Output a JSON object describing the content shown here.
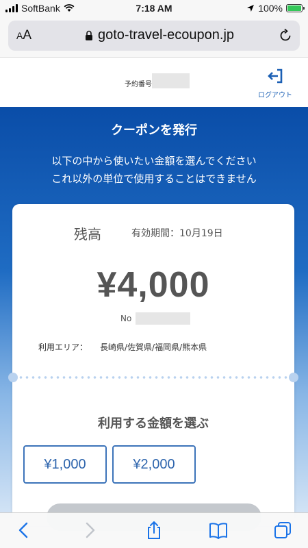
{
  "status_bar": {
    "carrier": "SoftBank",
    "time": "7:18 AM",
    "battery": "100%"
  },
  "url_bar": {
    "text_size_label_large": "A",
    "text_size_label_small": "A",
    "url": "goto-travel-ecoupon.jp"
  },
  "header": {
    "booking_label": "予約番号",
    "logout_label": "ログアウト"
  },
  "hero": {
    "title": "クーポンを発行",
    "description_line1": "以下の中から使いたい金額を選んでください",
    "description_line2": "これ以外の単位で使用することはできません"
  },
  "coupon": {
    "balance_label": "残高",
    "expiry": "有効期間：10月19日",
    "amount": "¥4,000",
    "number_label": "No",
    "area_label": "利用エリア：",
    "area_value": "長崎県/佐賀県/福岡県/熊本県"
  },
  "selection": {
    "title": "利用する金額を選ぶ",
    "options": [
      "¥1,000",
      "¥2,000"
    ]
  },
  "toolbar": {
    "icons": [
      "back-icon",
      "forward-icon",
      "share-icon",
      "bookmarks-icon",
      "tabs-icon"
    ]
  },
  "colors": {
    "primary_blue": "#0a4da8",
    "button_border": "#3c73b9",
    "safari_blue": "#1a73e8"
  }
}
